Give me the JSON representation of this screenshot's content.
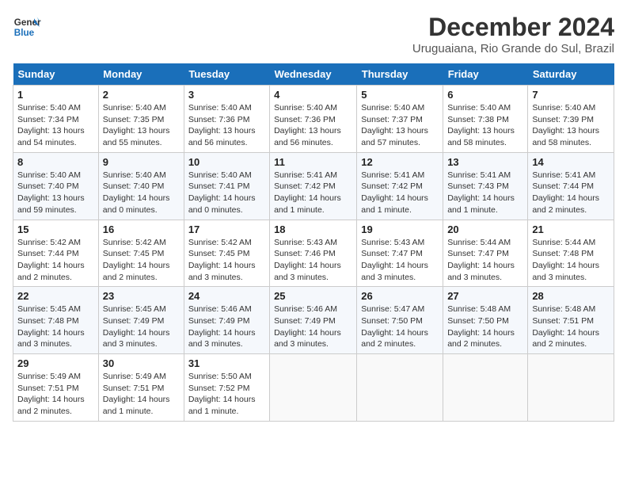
{
  "logo": {
    "text_general": "General",
    "text_blue": "Blue"
  },
  "title": "December 2024",
  "subtitle": "Uruguaiana, Rio Grande do Sul, Brazil",
  "days_of_week": [
    "Sunday",
    "Monday",
    "Tuesday",
    "Wednesday",
    "Thursday",
    "Friday",
    "Saturday"
  ],
  "weeks": [
    [
      {
        "day": "1",
        "sunrise": "Sunrise: 5:40 AM",
        "sunset": "Sunset: 7:34 PM",
        "daylight": "Daylight: 13 hours and 54 minutes."
      },
      {
        "day": "2",
        "sunrise": "Sunrise: 5:40 AM",
        "sunset": "Sunset: 7:35 PM",
        "daylight": "Daylight: 13 hours and 55 minutes."
      },
      {
        "day": "3",
        "sunrise": "Sunrise: 5:40 AM",
        "sunset": "Sunset: 7:36 PM",
        "daylight": "Daylight: 13 hours and 56 minutes."
      },
      {
        "day": "4",
        "sunrise": "Sunrise: 5:40 AM",
        "sunset": "Sunset: 7:36 PM",
        "daylight": "Daylight: 13 hours and 56 minutes."
      },
      {
        "day": "5",
        "sunrise": "Sunrise: 5:40 AM",
        "sunset": "Sunset: 7:37 PM",
        "daylight": "Daylight: 13 hours and 57 minutes."
      },
      {
        "day": "6",
        "sunrise": "Sunrise: 5:40 AM",
        "sunset": "Sunset: 7:38 PM",
        "daylight": "Daylight: 13 hours and 58 minutes."
      },
      {
        "day": "7",
        "sunrise": "Sunrise: 5:40 AM",
        "sunset": "Sunset: 7:39 PM",
        "daylight": "Daylight: 13 hours and 58 minutes."
      }
    ],
    [
      {
        "day": "8",
        "sunrise": "Sunrise: 5:40 AM",
        "sunset": "Sunset: 7:40 PM",
        "daylight": "Daylight: 13 hours and 59 minutes."
      },
      {
        "day": "9",
        "sunrise": "Sunrise: 5:40 AM",
        "sunset": "Sunset: 7:40 PM",
        "daylight": "Daylight: 14 hours and 0 minutes."
      },
      {
        "day": "10",
        "sunrise": "Sunrise: 5:40 AM",
        "sunset": "Sunset: 7:41 PM",
        "daylight": "Daylight: 14 hours and 0 minutes."
      },
      {
        "day": "11",
        "sunrise": "Sunrise: 5:41 AM",
        "sunset": "Sunset: 7:42 PM",
        "daylight": "Daylight: 14 hours and 1 minute."
      },
      {
        "day": "12",
        "sunrise": "Sunrise: 5:41 AM",
        "sunset": "Sunset: 7:42 PM",
        "daylight": "Daylight: 14 hours and 1 minute."
      },
      {
        "day": "13",
        "sunrise": "Sunrise: 5:41 AM",
        "sunset": "Sunset: 7:43 PM",
        "daylight": "Daylight: 14 hours and 1 minute."
      },
      {
        "day": "14",
        "sunrise": "Sunrise: 5:41 AM",
        "sunset": "Sunset: 7:44 PM",
        "daylight": "Daylight: 14 hours and 2 minutes."
      }
    ],
    [
      {
        "day": "15",
        "sunrise": "Sunrise: 5:42 AM",
        "sunset": "Sunset: 7:44 PM",
        "daylight": "Daylight: 14 hours and 2 minutes."
      },
      {
        "day": "16",
        "sunrise": "Sunrise: 5:42 AM",
        "sunset": "Sunset: 7:45 PM",
        "daylight": "Daylight: 14 hours and 2 minutes."
      },
      {
        "day": "17",
        "sunrise": "Sunrise: 5:42 AM",
        "sunset": "Sunset: 7:45 PM",
        "daylight": "Daylight: 14 hours and 3 minutes."
      },
      {
        "day": "18",
        "sunrise": "Sunrise: 5:43 AM",
        "sunset": "Sunset: 7:46 PM",
        "daylight": "Daylight: 14 hours and 3 minutes."
      },
      {
        "day": "19",
        "sunrise": "Sunrise: 5:43 AM",
        "sunset": "Sunset: 7:47 PM",
        "daylight": "Daylight: 14 hours and 3 minutes."
      },
      {
        "day": "20",
        "sunrise": "Sunrise: 5:44 AM",
        "sunset": "Sunset: 7:47 PM",
        "daylight": "Daylight: 14 hours and 3 minutes."
      },
      {
        "day": "21",
        "sunrise": "Sunrise: 5:44 AM",
        "sunset": "Sunset: 7:48 PM",
        "daylight": "Daylight: 14 hours and 3 minutes."
      }
    ],
    [
      {
        "day": "22",
        "sunrise": "Sunrise: 5:45 AM",
        "sunset": "Sunset: 7:48 PM",
        "daylight": "Daylight: 14 hours and 3 minutes."
      },
      {
        "day": "23",
        "sunrise": "Sunrise: 5:45 AM",
        "sunset": "Sunset: 7:49 PM",
        "daylight": "Daylight: 14 hours and 3 minutes."
      },
      {
        "day": "24",
        "sunrise": "Sunrise: 5:46 AM",
        "sunset": "Sunset: 7:49 PM",
        "daylight": "Daylight: 14 hours and 3 minutes."
      },
      {
        "day": "25",
        "sunrise": "Sunrise: 5:46 AM",
        "sunset": "Sunset: 7:49 PM",
        "daylight": "Daylight: 14 hours and 3 minutes."
      },
      {
        "day": "26",
        "sunrise": "Sunrise: 5:47 AM",
        "sunset": "Sunset: 7:50 PM",
        "daylight": "Daylight: 14 hours and 2 minutes."
      },
      {
        "day": "27",
        "sunrise": "Sunrise: 5:48 AM",
        "sunset": "Sunset: 7:50 PM",
        "daylight": "Daylight: 14 hours and 2 minutes."
      },
      {
        "day": "28",
        "sunrise": "Sunrise: 5:48 AM",
        "sunset": "Sunset: 7:51 PM",
        "daylight": "Daylight: 14 hours and 2 minutes."
      }
    ],
    [
      {
        "day": "29",
        "sunrise": "Sunrise: 5:49 AM",
        "sunset": "Sunset: 7:51 PM",
        "daylight": "Daylight: 14 hours and 2 minutes."
      },
      {
        "day": "30",
        "sunrise": "Sunrise: 5:49 AM",
        "sunset": "Sunset: 7:51 PM",
        "daylight": "Daylight: 14 hours and 1 minute."
      },
      {
        "day": "31",
        "sunrise": "Sunrise: 5:50 AM",
        "sunset": "Sunset: 7:52 PM",
        "daylight": "Daylight: 14 hours and 1 minute."
      },
      null,
      null,
      null,
      null
    ]
  ]
}
